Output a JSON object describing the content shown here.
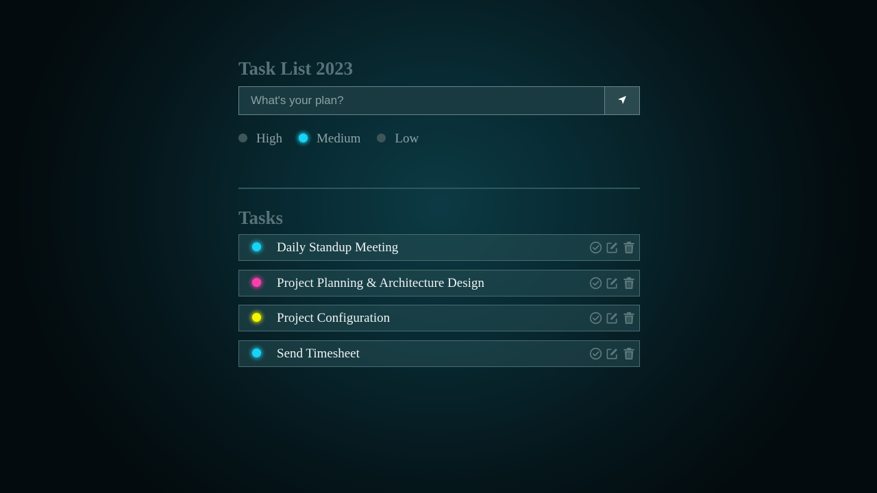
{
  "app": {
    "title": "Task List 2023"
  },
  "input": {
    "placeholder": "What's your plan?",
    "value": ""
  },
  "submit": {
    "icon": "send-arrow-icon"
  },
  "priorities": [
    {
      "label": "High",
      "selected": false
    },
    {
      "label": "Medium",
      "selected": true
    },
    {
      "label": "Low",
      "selected": false
    }
  ],
  "tasks_section": {
    "title": "Tasks"
  },
  "colors": {
    "high": "#ff3fae",
    "medium": "#19d3f5",
    "low": "#f5f500",
    "icon": "#5d797e"
  },
  "tasks": [
    {
      "label": "Daily Standup Meeting",
      "priority": "medium"
    },
    {
      "label": "Project Planning & Architecture Design",
      "priority": "high"
    },
    {
      "label": "Project Configuration",
      "priority": "low"
    },
    {
      "label": "Send Timesheet",
      "priority": "medium"
    }
  ]
}
